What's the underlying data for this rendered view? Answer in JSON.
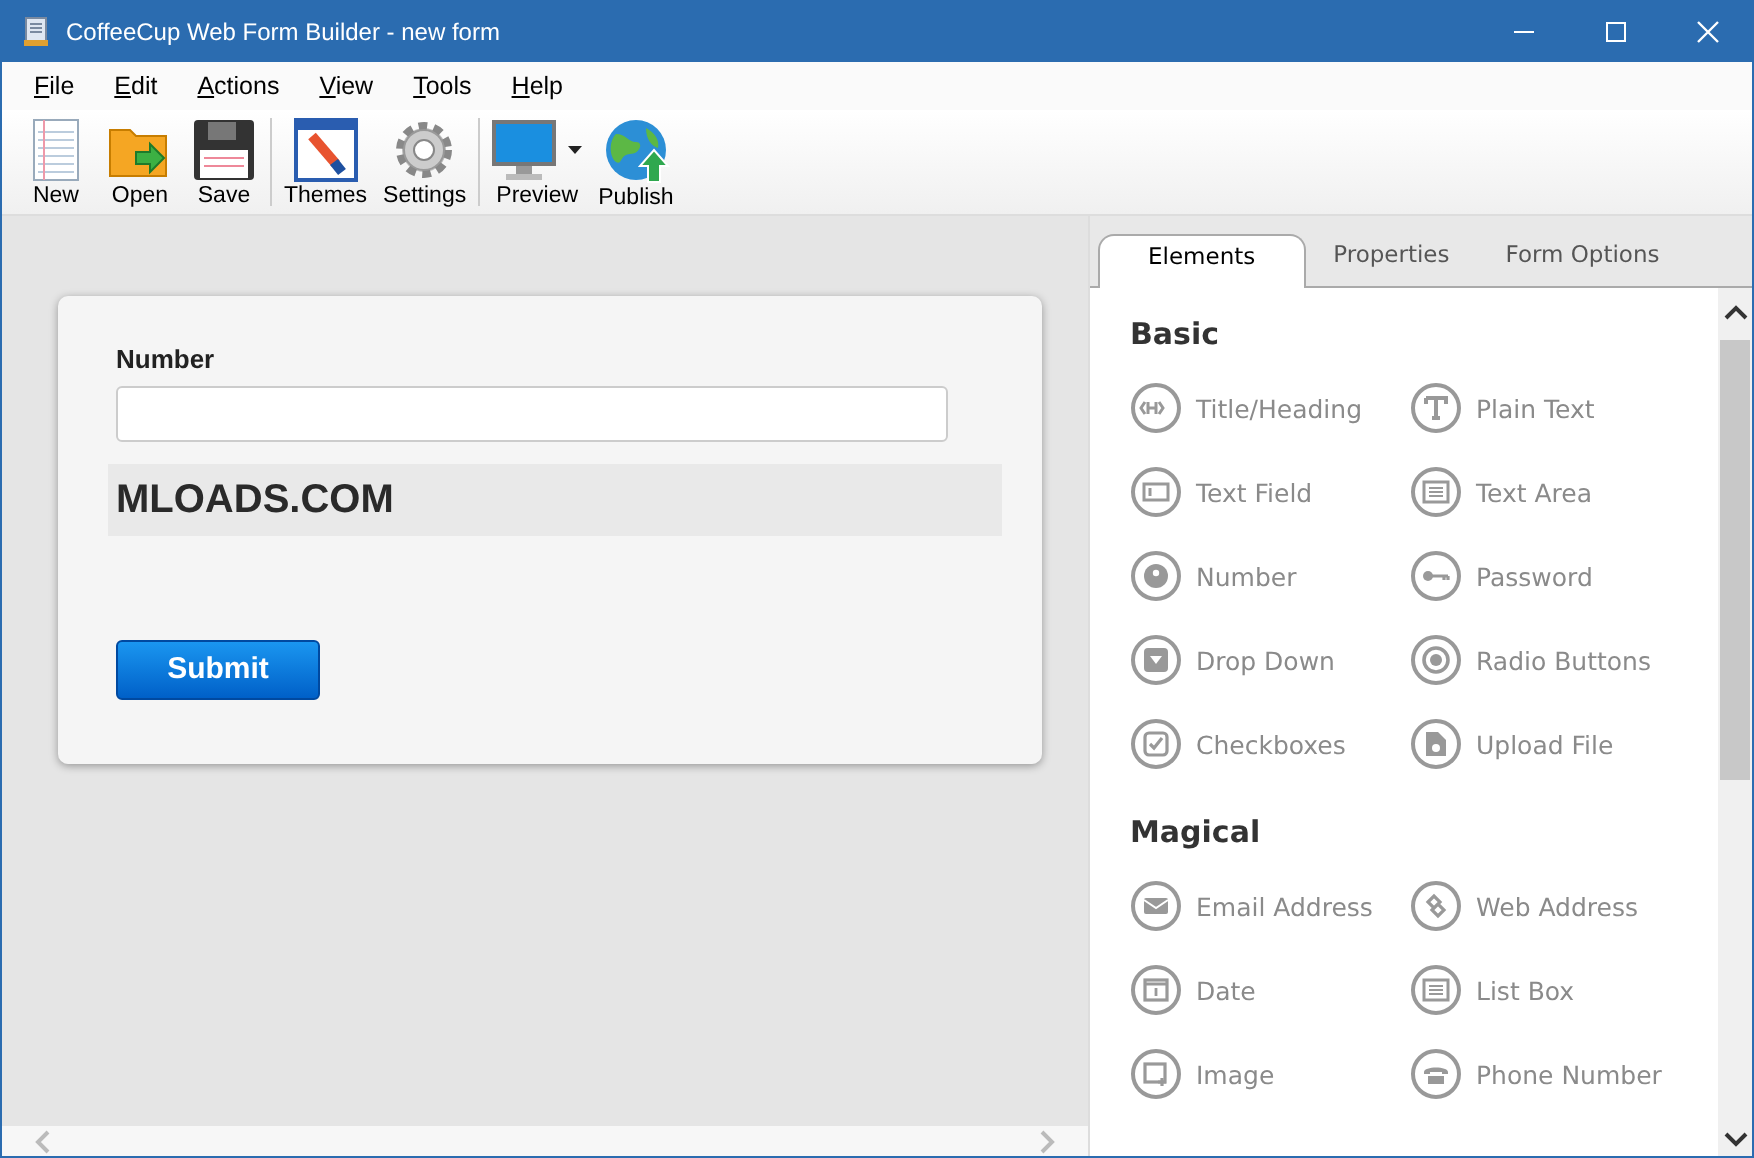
{
  "window": {
    "title": "CoffeeCup Web Form Builder - new form"
  },
  "menu": [
    "File",
    "Edit",
    "Actions",
    "View",
    "Tools",
    "Help"
  ],
  "toolbar": [
    {
      "label": "New",
      "kind": "new"
    },
    {
      "label": "Open",
      "kind": "open"
    },
    {
      "label": "Save",
      "kind": "save"
    },
    {
      "label": "Themes",
      "kind": "themes"
    },
    {
      "label": "Settings",
      "kind": "settings"
    },
    {
      "label": "Preview",
      "kind": "preview"
    },
    {
      "label": "Publish",
      "kind": "publish"
    }
  ],
  "form": {
    "field_label": "Number",
    "heading": "MLOADS.COM",
    "submit": "Submit"
  },
  "tabs": [
    {
      "label": "Elements",
      "selected": true
    },
    {
      "label": "Properties",
      "selected": false
    },
    {
      "label": "Form Options",
      "selected": false
    }
  ],
  "sections": [
    {
      "title": "Basic",
      "items": [
        "Title/Heading",
        "Plain Text",
        "Text Field",
        "Text Area",
        "Number",
        "Password",
        "Drop Down",
        "Radio Buttons",
        "Checkboxes",
        "Upload File"
      ]
    },
    {
      "title": "Magical",
      "items": [
        "Email Address",
        "Web Address",
        "Date",
        "List Box",
        "Image",
        "Phone Number"
      ]
    }
  ]
}
